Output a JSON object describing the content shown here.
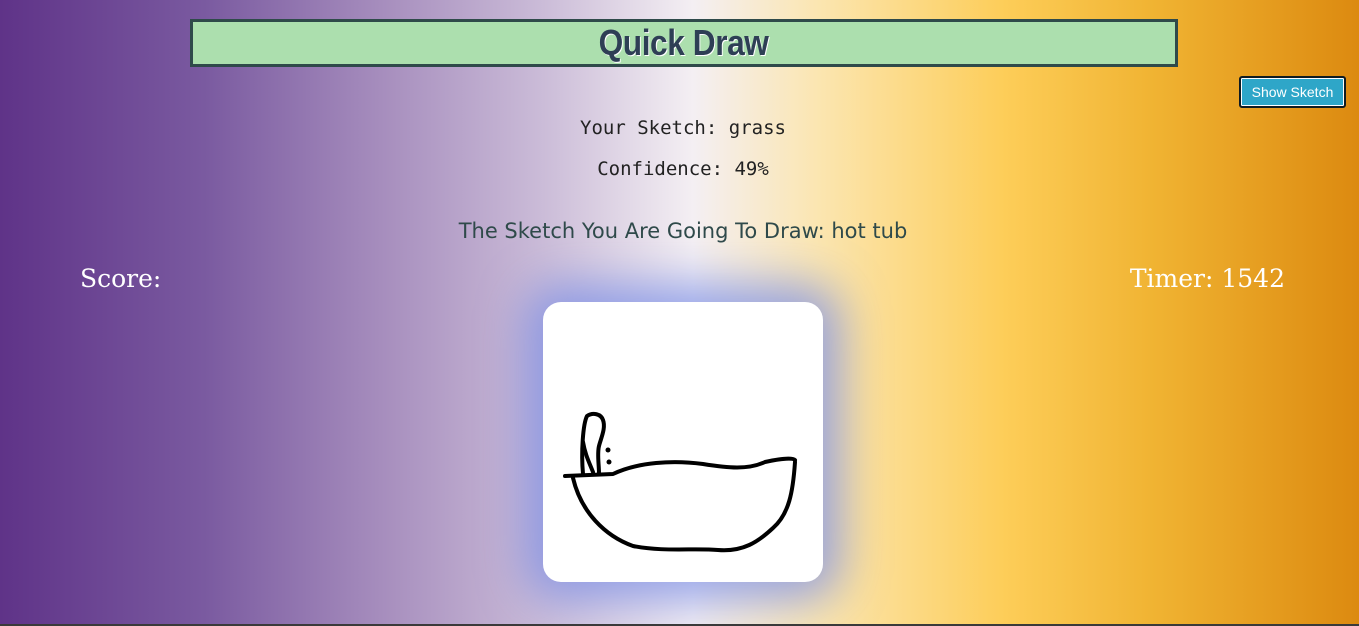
{
  "header": {
    "title": "Quick Draw"
  },
  "controls": {
    "show_sketch_label": "Show Sketch"
  },
  "prediction": {
    "sketch_text": "Your Sketch: grass",
    "confidence_text": "Confidence: 49%"
  },
  "target": {
    "prompt_text": "The Sketch You Are Going To Draw: hot tub"
  },
  "stats": {
    "score_text": "Score:",
    "timer_text": "Timer: 1542"
  },
  "colors": {
    "title_bg": "#acdfae",
    "title_border": "#2f4a4a",
    "button_bg": "#2ea6c8",
    "gradient_left": "#5f3388",
    "gradient_center": "#f4eff3",
    "gradient_right": "#dc8a10",
    "canvas_glow": "#788ce6"
  },
  "icons": {
    "canvas_drawing": "hot-tub-sketch"
  }
}
